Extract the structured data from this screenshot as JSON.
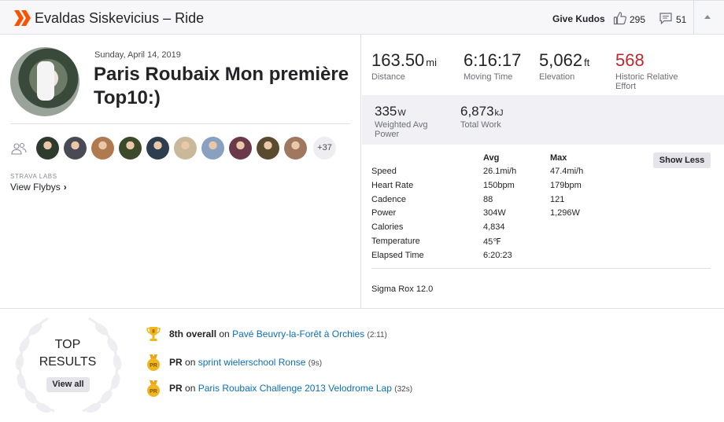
{
  "header": {
    "title": "Evaldas Siskevicius – Ride",
    "give_kudos": "Give Kudos",
    "kudos_count": "295",
    "comment_count": "51"
  },
  "activity": {
    "date": "Sunday, April 14, 2019",
    "name": "Paris Roubaix Mon première Top10:)",
    "more_athletes": "+37",
    "labs_label": "STRAVA LABS",
    "flyby_link": "View Flybys"
  },
  "athlete_colors": [
    "#2f3a2f",
    "#4a4a55",
    "#b07a50",
    "#3d4a2a",
    "#2c3e50",
    "#c9b89a",
    "#8aa0c0",
    "#6a3a4a",
    "#5a4a30",
    "#a07860"
  ],
  "stats": {
    "distance": {
      "value": "163.50",
      "unit": "mi",
      "label": "Distance"
    },
    "moving_time": {
      "value": "6:16:17",
      "label": "Moving Time"
    },
    "elevation": {
      "value": "5,062",
      "unit": "ft",
      "label": "Elevation"
    },
    "relative_effort": {
      "value": "568",
      "label": "Historic Relative Effort"
    },
    "power": {
      "value": "335",
      "unit": "W",
      "label": "Weighted Avg Power"
    },
    "work": {
      "value": "6,873",
      "unit": "kJ",
      "label": "Total Work"
    }
  },
  "details": {
    "avg_header": "Avg",
    "max_header": "Max",
    "show_less": "Show Less",
    "rows": [
      {
        "name": "Speed",
        "avg": "26.1mi/h",
        "max": "47.4mi/h"
      },
      {
        "name": "Heart Rate",
        "avg": "150bpm",
        "max": "179bpm"
      },
      {
        "name": "Cadence",
        "avg": "88",
        "max": "121"
      },
      {
        "name": "Power",
        "avg": "304W",
        "max": "1,296W"
      },
      {
        "name": "Calories",
        "avg": "4,834",
        "max": ""
      },
      {
        "name": "Temperature",
        "avg": "45℉",
        "max": ""
      },
      {
        "name": "Elapsed Time",
        "avg": "6:20:23",
        "max": ""
      }
    ],
    "device": "Sigma Rox 12.0"
  },
  "top_results": {
    "title_line1": "TOP",
    "title_line2": "RESULTS",
    "view_all": "View all",
    "items": [
      {
        "rank": "8th overall",
        "on": "on",
        "segment": "Pavé Beuvry-la-Forêt à Orchies",
        "time": "(2:11)",
        "badge": "trophy-icon"
      },
      {
        "rank": "PR",
        "on": "on",
        "segment": "sprint wielerschool Ronse",
        "time": "(9s)",
        "badge": "pr-medal-icon"
      },
      {
        "rank": "PR",
        "on": "on",
        "segment": "Paris Roubaix Challenge 2013 Velodrome Lap",
        "time": "(32s)",
        "badge": "pr-medal-icon"
      }
    ]
  },
  "colors": {
    "brand": "#fc5200",
    "relative_effort": "#c1272d",
    "link": "#0a6fb5",
    "gold": "#f2b51e"
  }
}
